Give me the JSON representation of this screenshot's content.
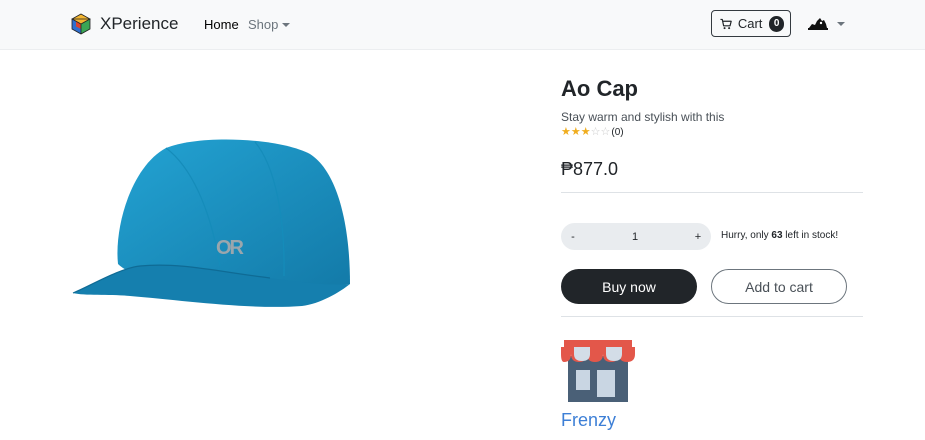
{
  "navbar": {
    "brand": "XPerience",
    "home": "Home",
    "shop": "Shop",
    "cart_label": "Cart",
    "cart_count": "0"
  },
  "product": {
    "title": "Ao Cap",
    "description": "Stay warm and stylish with this",
    "rating": 3,
    "rating_max": 5,
    "rating_count": "(0)",
    "price": "₱877.0",
    "image_logo_text": "OR",
    "quantity": "1",
    "qty_minus": "-",
    "qty_plus": "+",
    "stock_prefix": "Hurry, only ",
    "stock_count": "63",
    "stock_suffix": " left in stock!",
    "buy_label": "Buy now",
    "add_cart_label": "Add to cart"
  },
  "store": {
    "name": "Frenzy",
    "icon": "store-icon"
  },
  "colors": {
    "cap": "#1a8fbf",
    "star": "#f0ad1e",
    "store_link": "#3d7fd6"
  }
}
